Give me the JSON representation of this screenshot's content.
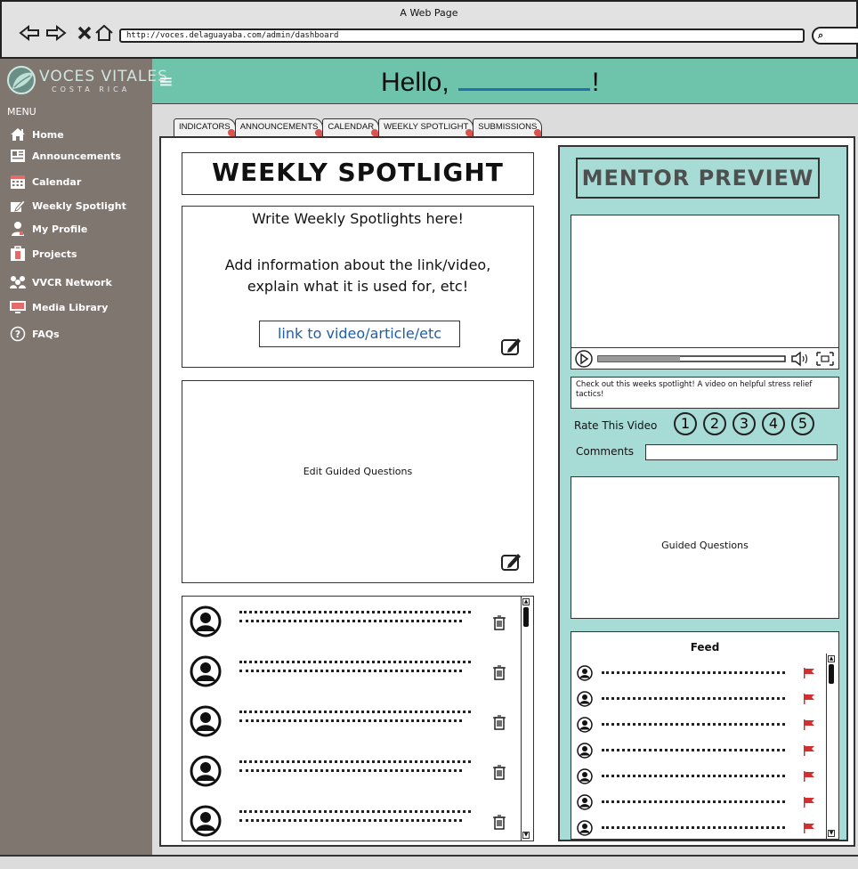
{
  "browser": {
    "window_title": "A Web Page",
    "url": "http://voces.delaguayaba.com/admin/dashboard",
    "search_icon": "search-icon"
  },
  "header": {
    "logo_name": "VOCES VITALES",
    "logo_sub": "COSTA RICA",
    "greeting_prefix": "Hello,",
    "greeting_suffix": "!",
    "background": "#6dc4ab"
  },
  "sidebar": {
    "menu_label": "MENU",
    "background": "#807670",
    "items": [
      {
        "label": "Home",
        "icon": "home-icon"
      },
      {
        "label": "Announcements",
        "icon": "newspaper-icon"
      },
      {
        "label": "Calendar",
        "icon": "calendar-icon"
      },
      {
        "label": "Weekly Spotlight",
        "icon": "edit-icon"
      },
      {
        "label": "My Profile",
        "icon": "user-icon"
      },
      {
        "label": "Projects",
        "icon": "folder-icon"
      },
      {
        "label": "VVCR Network",
        "icon": "network-icon"
      },
      {
        "label": "Media Library",
        "icon": "monitor-icon"
      },
      {
        "label": "FAQs",
        "icon": "help-icon"
      }
    ]
  },
  "tabs": [
    {
      "label": "INDICATORS"
    },
    {
      "label": "ANNOUNCEMENTS"
    },
    {
      "label": "CALENDAR"
    },
    {
      "label": "WEEKLY SPOTLIGHT"
    },
    {
      "label": "SUBMISSIONS"
    }
  ],
  "spotlight": {
    "title": "WEEKLY SPOTLIGHT",
    "line1": "Write Weekly Spotlights here!",
    "line2": "Add information about the link/video, explain what it is used for, etc!",
    "link_text": "link to video/article/etc",
    "guided_edit_label": "Edit Guided Questions",
    "comment_rows": 5
  },
  "mentor": {
    "title": "MENTOR PREVIEW",
    "caption": "Check out this weeks spotlight! A video on helpful stress relief tactics!",
    "rate_label": "Rate This Video",
    "ratings": [
      "1",
      "2",
      "3",
      "4",
      "5"
    ],
    "comments_label": "Comments",
    "comments_value": "",
    "guided_label": "Guided Questions",
    "feed_title": "Feed",
    "feed_rows": 7,
    "background": "#a7dcd6",
    "flag_color": "#d32f2f"
  }
}
